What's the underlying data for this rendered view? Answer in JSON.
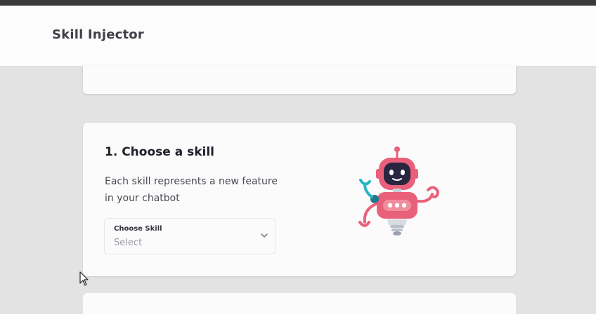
{
  "app": {
    "title": "Skill Injector"
  },
  "step": {
    "title": "1. Choose a skill",
    "description": "Each skill represents a new feature in your chatbot",
    "select": {
      "label": "Choose Skill",
      "placeholder": "Select"
    }
  },
  "icons": {
    "illustration": "robot-illustration-icon",
    "chevron": "chevron-down-icon",
    "cursor": "mouse-pointer-icon"
  },
  "colors": {
    "robot_pink": "#e8607a",
    "robot_teal": "#28b5c4",
    "robot_dark": "#2a2540"
  }
}
